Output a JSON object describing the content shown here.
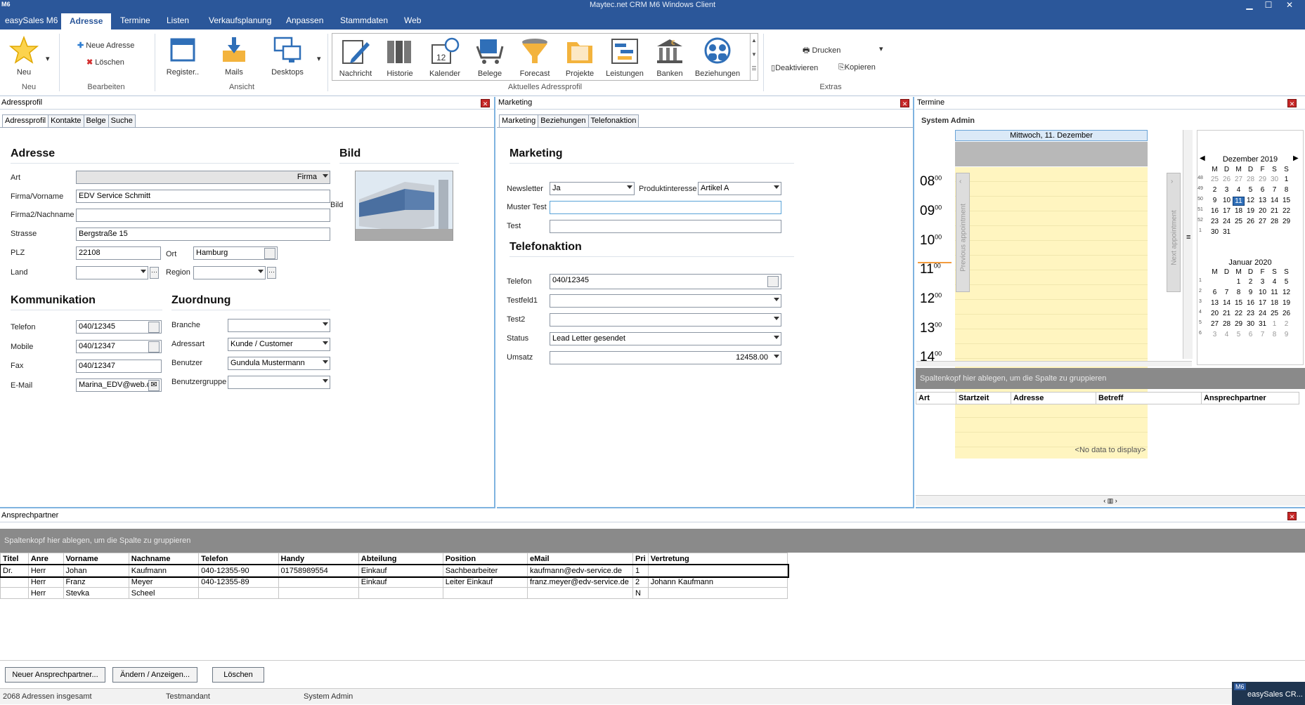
{
  "window": {
    "title": "Maytec.net CRM M6 Windows Client",
    "app_icon": "M6",
    "minimize": "▁",
    "maximize": "☐",
    "close": "✕"
  },
  "menu": [
    "easySales M6",
    "Adresse",
    "Termine",
    "Listen",
    "Verkaufsplanung",
    "Anpassen",
    "Stammdaten",
    "Web"
  ],
  "ribbon": {
    "neu": "Neu",
    "neu_group": "Neu",
    "neue_adresse": "Neue Adresse",
    "loeschen": "Löschen",
    "bearbeiten_group": "Bearbeiten",
    "register": "Register..",
    "mails": "Mails",
    "desktops": "Desktops",
    "ansicht_group": "Ansicht",
    "profil_items": [
      "Nachricht",
      "Historie",
      "Kalender",
      "Belege",
      "Forecast",
      "Projekte",
      "Leistungen",
      "Banken",
      "Beziehungen"
    ],
    "profil_group": "Aktuelles Adressprofil",
    "drucken": "Drucken",
    "deaktivieren": "Deaktivieren",
    "kopieren": "Kopieren",
    "extras_group": "Extras"
  },
  "adressprofil": {
    "title": "Adressprofil",
    "tabs": [
      "Adressprofil",
      "Kontakte",
      "Belge",
      "Suche"
    ],
    "h_adresse": "Adresse",
    "h_bild": "Bild",
    "bild_label": "Bild",
    "art_label": "Art",
    "art": "Firma",
    "firma_label": "Firma/Vorname",
    "firma": "EDV Service Schmitt",
    "firma2_label": "Firma2/Nachname",
    "firma2": "",
    "strasse_label": "Strasse",
    "strasse": "Bergstraße 15",
    "plz_label": "PLZ",
    "plz": "22108",
    "ort_label": "Ort",
    "ort": "Hamburg",
    "land_label": "Land",
    "land": "",
    "region_label": "Region",
    "region": "",
    "h_komm": "Kommunikation",
    "h_zuord": "Zuordnung",
    "telefon_label": "Telefon",
    "telefon": "040/12345",
    "mobile_label": "Mobile",
    "mobile": "040/12347",
    "fax_label": "Fax",
    "fax": "040/12347",
    "email_label": "E-Mail",
    "email": "Marina_EDV@web.de",
    "branche_label": "Branche",
    "branche": "",
    "adressart_label": "Adressart",
    "adressart": "Kunde / Customer",
    "benutzer_label": "Benutzer",
    "benutzer": "Gundula Mustermann",
    "bgruppe_label": "Benutzergruppe",
    "bgruppe": ""
  },
  "marketing": {
    "title": "Marketing",
    "tabs": [
      "Marketing",
      "Beziehungen",
      "Telefonaktion"
    ],
    "h_marketing": "Marketing",
    "newsletter_label": "Newsletter",
    "newsletter": "Ja",
    "produkt_label": "Produktinteresse",
    "produkt": "Artikel A",
    "mustertest_label": "Muster Test",
    "mustertest": "",
    "test_label": "Test",
    "test": "",
    "h_tel": "Telefonaktion",
    "telefon_label": "Telefon",
    "telefon": "040/12345",
    "testfeld1_label": "Testfeld1",
    "testfeld1": "",
    "test2_label": "Test2",
    "test2": "",
    "status_label": "Status",
    "status": "Lead Letter gesendet",
    "umsatz_label": "Umsatz",
    "umsatz": "12458.00"
  },
  "termine": {
    "title": "Termine",
    "user": "System Admin",
    "day": "Mittwoch, 11. Dezember",
    "hours": [
      "08",
      "09",
      "10",
      "11",
      "12",
      "13",
      "14"
    ],
    "minutes": "00",
    "prev": "Previous appointment",
    "next": "Next appointment",
    "month1": "Dezember 2019",
    "month2": "Januar 2020",
    "weekdays": [
      "M",
      "D",
      "M",
      "D",
      "F",
      "S",
      "S"
    ],
    "m1_weeks": [
      {
        "wk": "48",
        "days": [
          "25",
          "26",
          "27",
          "28",
          "29",
          "30",
          "1"
        ]
      },
      {
        "wk": "49",
        "days": [
          "2",
          "3",
          "4",
          "5",
          "6",
          "7",
          "8"
        ]
      },
      {
        "wk": "50",
        "days": [
          "9",
          "10",
          "11",
          "12",
          "13",
          "14",
          "15"
        ]
      },
      {
        "wk": "51",
        "days": [
          "16",
          "17",
          "18",
          "19",
          "20",
          "21",
          "22"
        ]
      },
      {
        "wk": "52",
        "days": [
          "23",
          "24",
          "25",
          "26",
          "27",
          "28",
          "29"
        ]
      },
      {
        "wk": "1",
        "days": [
          "30",
          "31",
          "",
          "",
          "",
          "",
          ""
        ]
      }
    ],
    "m2_weeks": [
      {
        "wk": "1",
        "days": [
          "",
          "",
          "1",
          "2",
          "3",
          "4",
          "5"
        ]
      },
      {
        "wk": "2",
        "days": [
          "6",
          "7",
          "8",
          "9",
          "10",
          "11",
          "12"
        ]
      },
      {
        "wk": "3",
        "days": [
          "13",
          "14",
          "15",
          "16",
          "17",
          "18",
          "19"
        ]
      },
      {
        "wk": "4",
        "days": [
          "20",
          "21",
          "22",
          "23",
          "24",
          "25",
          "26"
        ]
      },
      {
        "wk": "5",
        "days": [
          "27",
          "28",
          "29",
          "30",
          "31",
          "1",
          "2"
        ]
      },
      {
        "wk": "6",
        "days": [
          "3",
          "4",
          "5",
          "6",
          "7",
          "8",
          "9"
        ]
      }
    ],
    "group_hint": "Spaltenkopf hier ablegen, um die Spalte zu gruppieren",
    "cols": [
      "Art",
      "Startzeit",
      "Adresse",
      "Betreff",
      "Ansprechpartner"
    ],
    "nodata": "<No data to display>"
  },
  "ansprech": {
    "title": "Ansprechpartner",
    "group_hint": "Spaltenkopf hier ablegen, um die Spalte zu gruppieren",
    "cols": [
      "Titel",
      "Anre",
      "Vorname",
      "Nachname",
      "Telefon",
      "Handy",
      "Abteilung",
      "Position",
      "eMail",
      "Pri",
      "Vertretung"
    ],
    "rows": [
      [
        "Dr.",
        "Herr",
        "Johan",
        "Kaufmann",
        "040-12355-90",
        "01758989554",
        "Einkauf",
        "Sachbearbeiter",
        "kaufmann@edv-service.de",
        "1",
        ""
      ],
      [
        "",
        "Herr",
        "Franz",
        "Meyer",
        "040-12355-89",
        "",
        "Einkauf",
        "Leiter Einkauf",
        "franz.meyer@edv-service.de",
        "2",
        "Johann Kaufmann"
      ],
      [
        "",
        "Herr",
        "Stevka",
        "Scheel",
        "",
        "",
        "",
        "",
        "",
        "N",
        ""
      ]
    ],
    "btn_new": "Neuer Ansprechpartner...",
    "btn_edit": "Ändern / Anzeigen...",
    "btn_del": "Löschen"
  },
  "status": {
    "count": "2068 Adressen insgesamt",
    "mandant": "Testmandant",
    "user": "System Admin"
  },
  "taskbar": {
    "badge": "M6",
    "label": "easySales CR..."
  }
}
